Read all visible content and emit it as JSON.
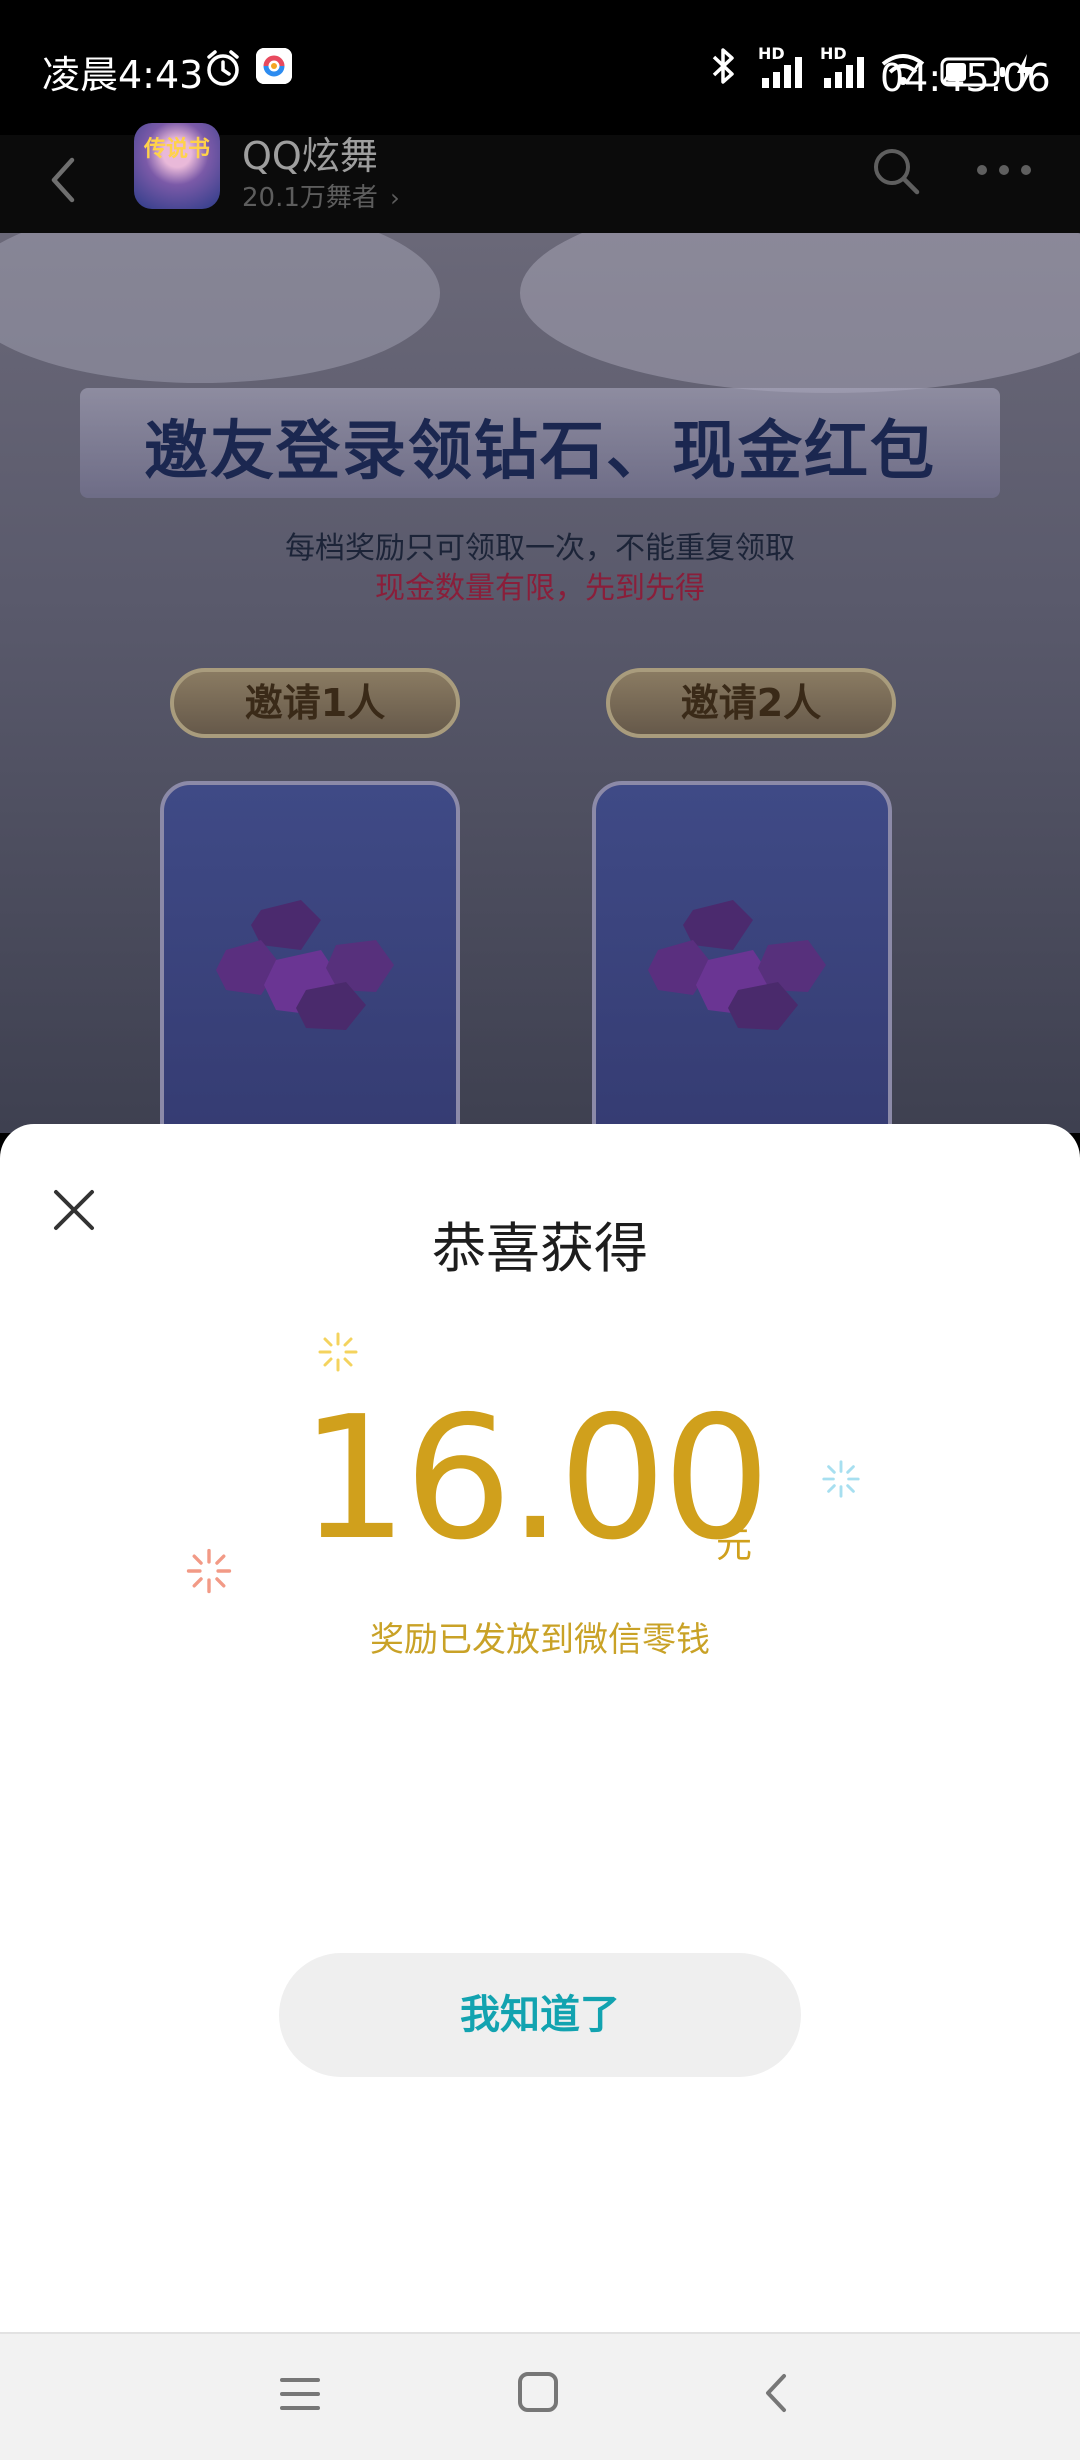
{
  "status_bar": {
    "time": "凌晨4:43",
    "clock_overlay": "04:45:06",
    "network_1": "HD",
    "network_2": "HD",
    "icons": [
      "alarm-icon",
      "app-notification-icon",
      "bluetooth-icon",
      "signal-icon",
      "signal-icon",
      "wifi-icon",
      "battery-icon",
      "charging-icon"
    ]
  },
  "header": {
    "app_name": "QQ炫舞",
    "followers": "20.1万舞者",
    "logo_text": "传说书",
    "icons": [
      "back-icon",
      "search-icon",
      "more-icon"
    ]
  },
  "page": {
    "banner_title": "邀友登录领钻石、现金红包",
    "rule_line1": "每档奖励只可领取一次，不能重复领取",
    "rule_line2": "现金数量有限，先到先得",
    "tiers": [
      {
        "label": "邀请1人"
      },
      {
        "label": "邀请2人"
      }
    ]
  },
  "modal": {
    "title": "恭喜获得",
    "amount": "16.00",
    "unit": "元",
    "description": "奖励已发放到微信零钱",
    "button_label": "我知道了",
    "colors": {
      "amount": "#d0a01c",
      "button_text": "#12a3b0"
    }
  },
  "nav": {
    "icons": [
      "menu-icon",
      "home-icon",
      "back-icon"
    ]
  }
}
